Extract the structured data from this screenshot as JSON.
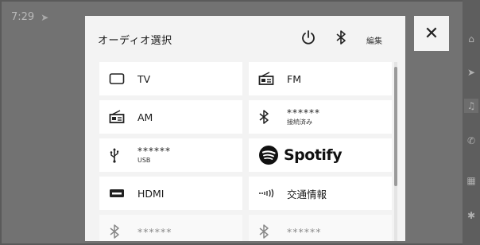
{
  "status_bar": {
    "time": "7:29"
  },
  "sidebar_icons": [
    "home-icon",
    "navigation-icon",
    "music-icon",
    "phone-icon",
    "apps-icon",
    "settings-icon"
  ],
  "modal": {
    "title": "オーディオ選択",
    "edit_label": "編集"
  },
  "close_icon": "close-icon",
  "sources": [
    {
      "label": "TV",
      "sublabel": "",
      "icon": "tv-icon"
    },
    {
      "label": "FM",
      "sublabel": "",
      "icon": "radio-icon"
    },
    {
      "label": "AM",
      "sublabel": "",
      "icon": "radio-icon"
    },
    {
      "label": "******",
      "sublabel": "接続済み",
      "icon": "bluetooth-icon"
    },
    {
      "label": "******",
      "sublabel": "USB",
      "icon": "usb-icon"
    },
    {
      "label": "Spotify",
      "sublabel": "",
      "icon": "spotify-icon"
    },
    {
      "label": "HDMI",
      "sublabel": "",
      "icon": "hdmi-icon"
    },
    {
      "label": "交通情報",
      "sublabel": "",
      "icon": "traffic-info-icon"
    },
    {
      "label": "******",
      "sublabel": "",
      "icon": "bluetooth-icon"
    },
    {
      "label": "******",
      "sublabel": "",
      "icon": "bluetooth-icon"
    }
  ],
  "colors": {
    "modal_bg": "#f3f3f3",
    "tile_bg": "#ffffff",
    "backdrop": "#727272"
  }
}
